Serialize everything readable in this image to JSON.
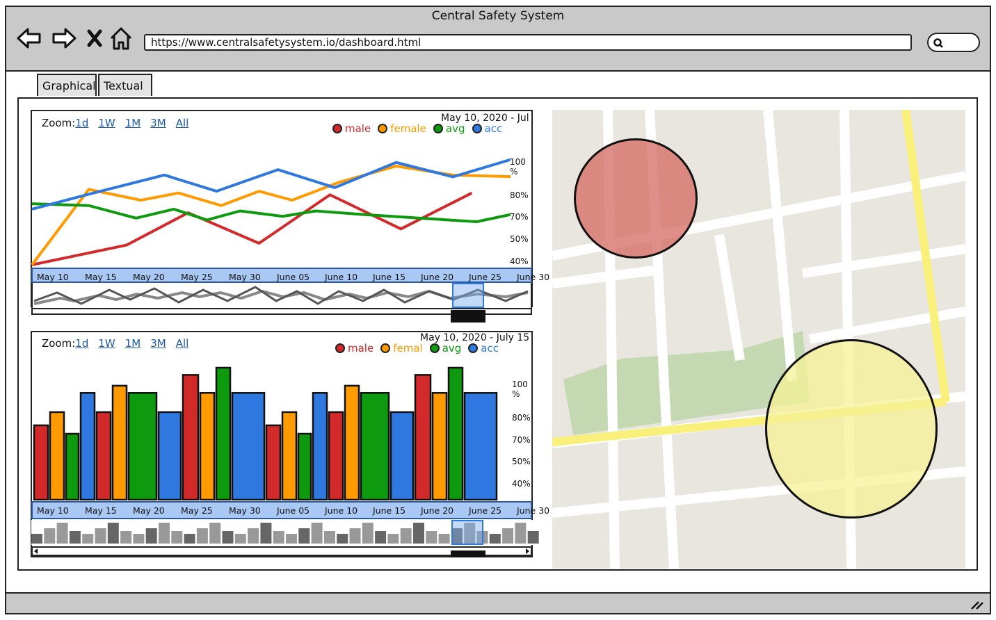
{
  "window": {
    "title": "Central Safety System"
  },
  "browser": {
    "url": "https://www.centralsafetysystem.io/dashboard.html",
    "back_icon": "arrow-left-icon",
    "forward_icon": "arrow-right-icon",
    "stop_icon": "close-icon",
    "home_icon": "home-icon",
    "search_icon": "search-icon"
  },
  "tabs": [
    {
      "label": "Graphical",
      "active": true
    },
    {
      "label": "Textual",
      "active": false
    }
  ],
  "line_panel": {
    "zoom_label": "Zoom:",
    "zoom_options": [
      "1d",
      "1W",
      "1M",
      "3M",
      "All"
    ],
    "date_range": "May 10, 2020 - Jul",
    "legend": [
      "male",
      "female",
      "avg",
      "acc"
    ]
  },
  "bar_panel": {
    "zoom_label": "Zoom:",
    "zoom_options": [
      "1d",
      "1W",
      "1M",
      "3M",
      "All"
    ],
    "date_range": "May 10, 2020 - July 15,",
    "legend": [
      "male",
      "femal",
      "avg",
      "acc"
    ]
  },
  "colors": {
    "male": "#d22a2a",
    "female": "#ff9a00",
    "avg": "#0e9a0e",
    "acc": "#2e78e0",
    "axis_band": "#a9c8f4",
    "map_bg": "#e9e6df",
    "map_park": "#c4d9b1",
    "map_road": "#f8f07a"
  },
  "chart_data": [
    {
      "type": "line",
      "categories": [
        "May 10",
        "May 15",
        "May 20",
        "May 25",
        "May 30",
        "June 05",
        "June 10",
        "June 15",
        "June 20",
        "June 25",
        "June 30"
      ],
      "yticks": [
        "100 %",
        "80%",
        "70%",
        "50%",
        "40%"
      ],
      "series": [
        {
          "name": "male",
          "points": [
            [
              0,
              40
            ],
            [
              2,
              51
            ],
            [
              3.3,
              69
            ],
            [
              4.8,
              52
            ],
            [
              6.3,
              79
            ],
            [
              7.8,
              60
            ],
            [
              9.3,
              80
            ]
          ]
        },
        {
          "name": "female",
          "points": [
            [
              0,
              40
            ],
            [
              1.2,
              82
            ],
            [
              2.3,
              76
            ],
            [
              3.1,
              80
            ],
            [
              4.0,
              73
            ],
            [
              4.8,
              81
            ],
            [
              5.5,
              76
            ],
            [
              6.5,
              86
            ],
            [
              7.7,
              95
            ],
            [
              8.9,
              90
            ],
            [
              10.3,
              89
            ]
          ]
        },
        {
          "name": "avg",
          "points": [
            [
              0,
              74
            ],
            [
              1.2,
              73
            ],
            [
              2.2,
              66
            ],
            [
              3.0,
              71
            ],
            [
              3.7,
              65
            ],
            [
              4.4,
              70
            ],
            [
              5.3,
              67
            ],
            [
              6.0,
              70
            ],
            [
              7.0,
              68
            ],
            [
              9.4,
              64
            ],
            [
              10.3,
              69
            ]
          ]
        },
        {
          "name": "acc",
          "points": [
            [
              0,
              71
            ],
            [
              1.3,
              80
            ],
            [
              2.8,
              90
            ],
            [
              3.9,
              81
            ],
            [
              5.2,
              93
            ],
            [
              6.4,
              83
            ],
            [
              7.7,
              97
            ],
            [
              8.9,
              89
            ],
            [
              10.3,
              100
            ]
          ]
        }
      ]
    },
    {
      "type": "bar",
      "categories": [
        "May 10",
        "May 15",
        "May 20",
        "May 25",
        "May 30",
        "June 05",
        "June 10",
        "June 15",
        "June 20",
        "June 25",
        "June 30"
      ],
      "yticks": [
        "100 %",
        "80%",
        "70%",
        "50%",
        "40%"
      ],
      "bars": [
        {
          "series": "male",
          "value": 62
        },
        {
          "series": "female",
          "value": 73
        },
        {
          "series": "avg",
          "value": 55
        },
        {
          "series": "acc",
          "value": 89
        },
        {
          "series": "male",
          "value": 73
        },
        {
          "series": "female",
          "value": 95
        },
        {
          "series": "avg",
          "value": 89
        },
        {
          "series": "acc",
          "value": 73
        },
        {
          "series": "male",
          "value": 104
        },
        {
          "series": "female",
          "value": 89
        },
        {
          "series": "avg",
          "value": 110
        },
        {
          "series": "acc",
          "value": 89
        },
        {
          "series": "male",
          "value": 62
        },
        {
          "series": "female",
          "value": 73
        },
        {
          "series": "avg",
          "value": 55
        },
        {
          "series": "acc",
          "value": 89
        },
        {
          "series": "male",
          "value": 73
        },
        {
          "series": "female",
          "value": 95
        },
        {
          "series": "avg",
          "value": 89
        },
        {
          "series": "acc",
          "value": 73
        },
        {
          "series": "male",
          "value": 104
        },
        {
          "series": "female",
          "value": 89
        },
        {
          "series": "avg",
          "value": 110
        },
        {
          "series": "acc",
          "value": 89
        }
      ]
    }
  ]
}
